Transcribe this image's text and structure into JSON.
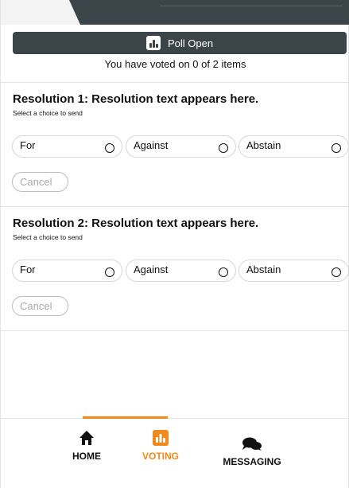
{
  "poll": {
    "status": "Poll Open",
    "icon": "poll-chart-icon",
    "voted_text": "You have voted on 0 of 2 items"
  },
  "resolutions": [
    {
      "title": "Resolution 1: Resolution text appears here.",
      "subtitle": "Select a choice to send",
      "choices": [
        "For",
        "Against",
        "Abstain"
      ],
      "cancel": "Cancel"
    },
    {
      "title": "Resolution 2: Resolution text appears here.",
      "subtitle": "Select a choice to send",
      "choices": [
        "For",
        "Against",
        "Abstain"
      ],
      "cancel": "Cancel"
    }
  ],
  "nav": {
    "home": "HOME",
    "voting": "VOTING",
    "messaging": "MESSAGING",
    "active": "voting"
  },
  "colors": {
    "accent": "#f08a1c",
    "dark": "#3b4549"
  }
}
